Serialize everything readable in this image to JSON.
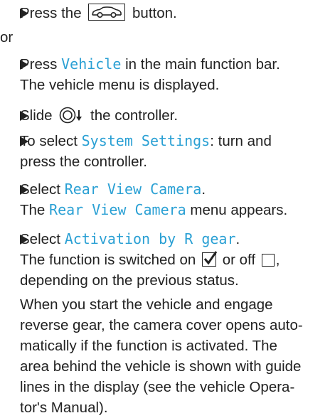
{
  "steps": {
    "s1": {
      "before": "Press the",
      "after": "button."
    },
    "or_label": "or",
    "s2": {
      "before": "Press",
      "term": "Vehicle",
      "after": "in the main function bar.",
      "line2": "The vehicle menu is displayed."
    },
    "s3": {
      "before": "Slide",
      "after": "the controller."
    },
    "s4": {
      "before": "To select",
      "term": "System Settings",
      "after": ": turn and",
      "line2": "press the controller."
    },
    "s5": {
      "before": "Select",
      "term": "Rear View Camera",
      "after": ".",
      "line2_before": "The",
      "line2_term": "Rear View Camera",
      "line2_after": "menu appears."
    },
    "s6": {
      "before": "Select",
      "term": "Activation by R gear",
      "after": ".",
      "line2_before": "The function is switched on",
      "line2_mid": "or off",
      "line2_after": ",",
      "line3": "depending on the previous status."
    }
  },
  "paragraph": {
    "l1": "When you start the vehicle and engage",
    "l2": "reverse gear, the camera cover opens auto-",
    "l3": "matically if the function is activated. The",
    "l4": "area behind the vehicle is shown with guide",
    "l5": "lines in the display (see the vehicle Opera-",
    "l6": "tor's Manual)."
  },
  "icons": {
    "car_button": "vehicle-button-icon",
    "controller": "controller-slide-down-icon",
    "checked": "checkbox-checked-icon",
    "unchecked": "checkbox-unchecked-icon"
  },
  "colors": {
    "term": "#2aa0d4",
    "text": "#222222"
  }
}
